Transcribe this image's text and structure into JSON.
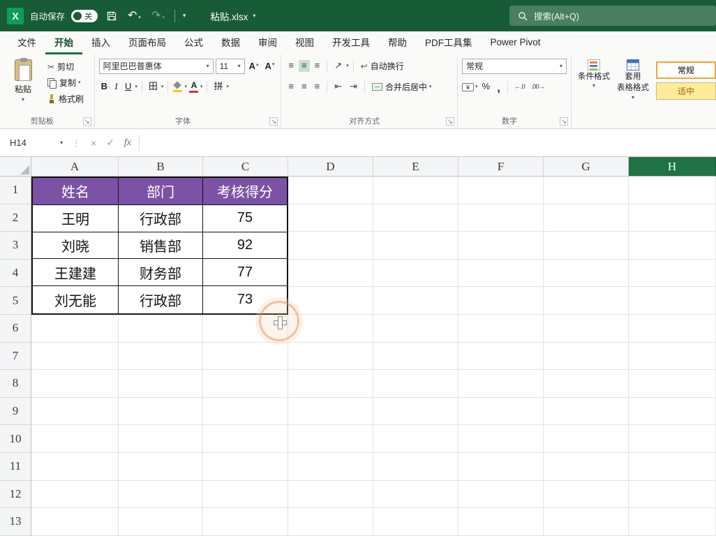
{
  "titlebar": {
    "autosave_label": "自动保存",
    "autosave_state": "关",
    "filename": "粘贴.xlsx",
    "search_placeholder": "搜索(Alt+Q)"
  },
  "menu_tabs": [
    {
      "label": "文件"
    },
    {
      "label": "开始"
    },
    {
      "label": "插入"
    },
    {
      "label": "页面布局"
    },
    {
      "label": "公式"
    },
    {
      "label": "数据"
    },
    {
      "label": "审阅"
    },
    {
      "label": "视图"
    },
    {
      "label": "开发工具"
    },
    {
      "label": "帮助"
    },
    {
      "label": "PDF工具集"
    },
    {
      "label": "Power Pivot"
    }
  ],
  "ribbon": {
    "clipboard": {
      "paste": "粘贴",
      "cut": "剪切",
      "copy": "复制",
      "format_painter": "格式刷",
      "group_label": "剪贴板"
    },
    "font": {
      "font_name": "阿里巴巴普惠体",
      "font_size": "11",
      "group_label": "字体"
    },
    "alignment": {
      "wrap_text": "自动换行",
      "merge_center": "合并后居中",
      "group_label": "对齐方式"
    },
    "number": {
      "format": "常规",
      "group_label": "数字"
    },
    "styles": {
      "conditional": "条件格式",
      "table_format_line1": "套用",
      "table_format_line2": "表格格式",
      "cell_style_normal": "常规",
      "cell_style_neutral": "适中"
    }
  },
  "formula_bar": {
    "name_box": "H14",
    "formula": ""
  },
  "grid": {
    "columns": [
      "A",
      "B",
      "C",
      "D",
      "E",
      "F",
      "G",
      "H"
    ],
    "selected_column": "H",
    "rows": [
      "1",
      "2",
      "3",
      "4",
      "5",
      "6",
      "7",
      "8",
      "9",
      "10",
      "11",
      "12",
      "13"
    ]
  },
  "table": {
    "headers": [
      "姓名",
      "部门",
      "考核得分"
    ],
    "rows": [
      [
        "王明",
        "行政部",
        "75"
      ],
      [
        "刘晓",
        "销售部",
        "92"
      ],
      [
        "王建建",
        "财务部",
        "77"
      ],
      [
        "刘无能",
        "行政部",
        "73"
      ]
    ],
    "header_bg": "#7B52A5"
  },
  "icons": {
    "caret_down": "▾",
    "caret_up": "▴",
    "undo": "↶",
    "redo": "↷",
    "scissors": "✂",
    "cancel": "×",
    "enter": "✓",
    "fx": "fx",
    "dots": "⋮",
    "bold": "B",
    "italic": "I",
    "underline": "U",
    "borders": "田",
    "font_letter": "A",
    "align_bars": "≡",
    "orientation": "↗",
    "wrap": "↩",
    "indent_dec": "⇤",
    "indent_inc": "⇥",
    "currency": "¥",
    "percent": "%",
    "comma": ",",
    "dec_increase": "←.0",
    "dec_decrease": ".00→",
    "launcher": "↘",
    "phonetic": "拼"
  },
  "colors": {
    "titlebar_green": "#185C37",
    "accent_green": "#217346",
    "table_header_purple": "#7B52A5",
    "neutral_style_bg": "#FFEB9C",
    "neutral_style_text": "#9C6500"
  }
}
